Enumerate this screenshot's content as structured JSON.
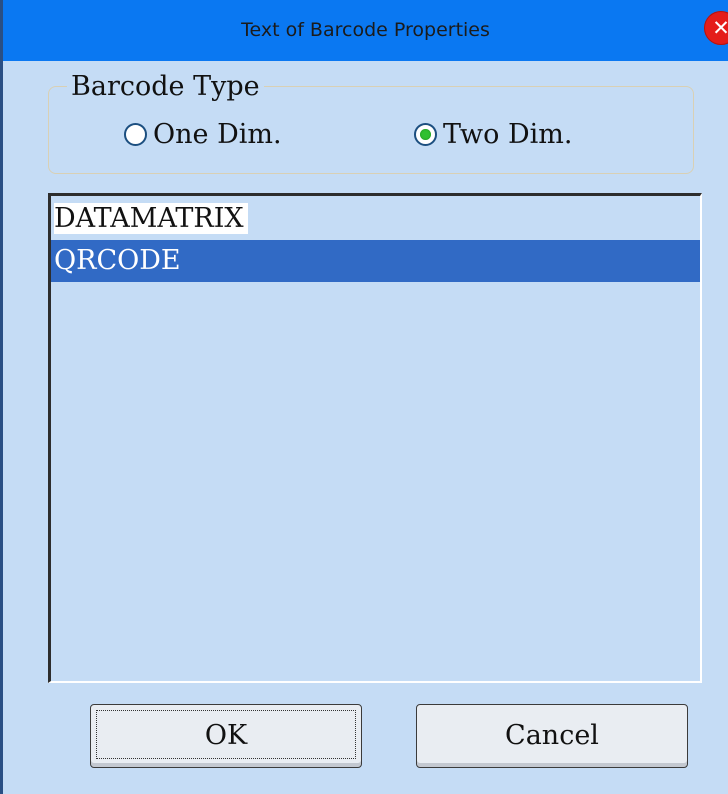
{
  "window": {
    "title": "Text of Barcode Properties",
    "close_glyph": "✕"
  },
  "barcode_type": {
    "legend": "Barcode Type",
    "options": [
      {
        "label": "One Dim.",
        "selected": false
      },
      {
        "label": "Two Dim.",
        "selected": true
      }
    ]
  },
  "list": {
    "items": [
      {
        "label": "DATAMATRIX",
        "selected": false
      },
      {
        "label": "QRCODE",
        "selected": true
      }
    ]
  },
  "buttons": {
    "ok": "OK",
    "cancel": "Cancel"
  },
  "colors": {
    "titlebar": "#0a78f2",
    "dialog_bg": "#c5dcf5",
    "selection": "#316ac5",
    "radio_dot": "#30c030",
    "close": "#e41d1a"
  }
}
